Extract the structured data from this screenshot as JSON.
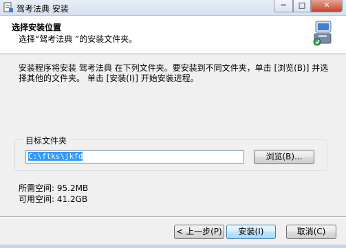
{
  "window": {
    "title": "驾考法典 安装",
    "minimize_label": "─",
    "maximize_label": "□",
    "close_label": "✕"
  },
  "header": {
    "title": "选择安装位置",
    "subtitle": "选择“驾考法典 ”的安装文件夹。"
  },
  "description": "安装程序将安装 驾考法典 在下列文件夹。要安装到不同文件夹，单击 [浏览(B)] 并选择其他的文件夹。 单击 [安装(I)] 开始安装进程。",
  "destination": {
    "group_label": "目标文件夹",
    "path": "C:\\ftks\\jkfd",
    "browse_label": "浏览(B)..."
  },
  "space": {
    "required": "所需空间: 95.2MB",
    "available": "可用空间: 41.2GB"
  },
  "buttons": {
    "back": "< 上一步(P)",
    "install": "安装(I)",
    "cancel": "取消(C)"
  }
}
